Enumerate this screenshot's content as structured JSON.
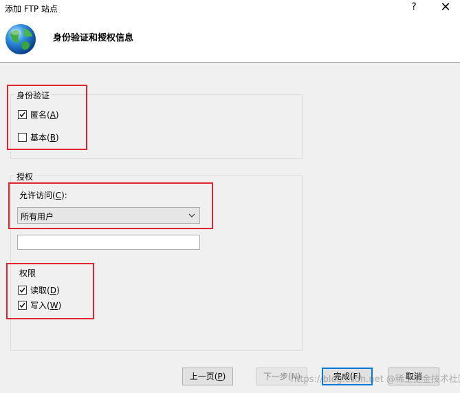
{
  "window": {
    "title": "添加 FTP 站点",
    "help_label": "?",
    "close_label": "✕"
  },
  "header": {
    "heading": "身份验证和授权信息",
    "icon": "globe-icon"
  },
  "authentication": {
    "legend": "身份验证",
    "anonymous": {
      "label_main": "匿名(",
      "label_key": "A",
      "label_end": ")",
      "checked": true
    },
    "basic": {
      "label_main": "基本(",
      "label_key": "B",
      "label_end": ")",
      "checked": false
    }
  },
  "authorization": {
    "legend": "授权",
    "allow_access_label_main": "允许访问(",
    "allow_access_label_key": "C",
    "allow_access_label_end": "):",
    "allow_access_value": "所有用户",
    "user_text_value": ""
  },
  "permissions": {
    "legend": "权限",
    "read": {
      "label_main": "读取(",
      "label_key": "D",
      "label_end": ")",
      "checked": true
    },
    "write": {
      "label_main": "写入(",
      "label_key": "W",
      "label_end": ")",
      "checked": true
    }
  },
  "footer": {
    "prev_label_main": "上一页(",
    "prev_label_key": "P",
    "prev_label_end": ")",
    "next_label": "下一步(N)",
    "finish_label": "完成(F)",
    "cancel_label": "取消",
    "watermark": "https://blog.csdn.net @稀土掘金技术社区"
  },
  "colors": {
    "highlight": "#e0262c",
    "accent": "#0078d7"
  }
}
